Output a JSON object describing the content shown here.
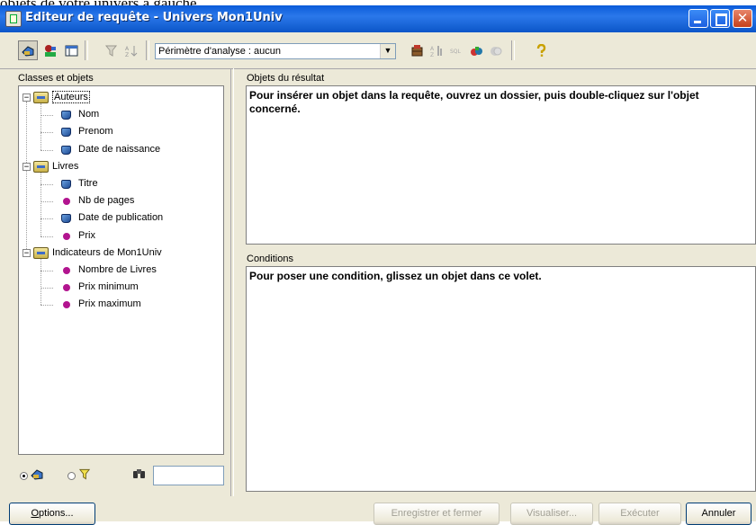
{
  "page_fragment_text": "objets de votre univers à gauche.",
  "window": {
    "title": "Editeur de requête - Univers Mon1Univ",
    "min_label": "",
    "max_label": "",
    "close_label": "✕"
  },
  "toolbar": {
    "scope_combo_value": "Périmètre d'analyse : aucun",
    "combo_arrow": "▼",
    "icons": [
      "classes-objects-icon",
      "query-properties-icon",
      "table-view-icon",
      "filter-icon",
      "sort-icon",
      "tables-icon",
      "sort-order-icon",
      "sql-icon",
      "data-providers-icon",
      "combine-icon",
      "help-icon"
    ]
  },
  "left_panel": {
    "title": "Classes et objets",
    "tree": [
      {
        "type": "class",
        "label": "Auteurs",
        "expanded": true,
        "selected": true,
        "children": [
          {
            "type": "dimension",
            "label": "Nom"
          },
          {
            "type": "dimension",
            "label": "Prenom"
          },
          {
            "type": "dimension",
            "label": "Date de naissance"
          }
        ]
      },
      {
        "type": "class",
        "label": "Livres",
        "expanded": true,
        "children": [
          {
            "type": "dimension",
            "label": "Titre"
          },
          {
            "type": "indicator",
            "label": "Nb de pages"
          },
          {
            "type": "dimension",
            "label": "Date de publication"
          },
          {
            "type": "indicator",
            "label": "Prix"
          }
        ]
      },
      {
        "type": "class",
        "label": "Indicateurs de Mon1Univ",
        "expanded": true,
        "children": [
          {
            "type": "indicator",
            "label": "Nombre de Livres"
          },
          {
            "type": "indicator",
            "label": "Prix minimum"
          },
          {
            "type": "indicator",
            "label": "Prix maximum"
          }
        ]
      }
    ],
    "view_mode": "objects",
    "search_value": ""
  },
  "result_panel": {
    "title": "Objets du résultat",
    "hint": "Pour insérer un objet dans la requête, ouvrez un dossier, puis double-cliquez sur l'objet concerné."
  },
  "conditions_panel": {
    "title": "Conditions",
    "hint": "Pour poser une condition, glissez un objet dans ce volet."
  },
  "buttons": {
    "options": {
      "label_mnemonic": "O",
      "label_rest": "ptions...",
      "enabled": true
    },
    "save_close": {
      "label": "Enregistrer et fermer",
      "enabled": false
    },
    "preview": {
      "label": "Visualiser...",
      "enabled": false
    },
    "run": {
      "label": "Exécuter",
      "enabled": false
    },
    "cancel": {
      "label": "Annuler",
      "enabled": true
    }
  }
}
